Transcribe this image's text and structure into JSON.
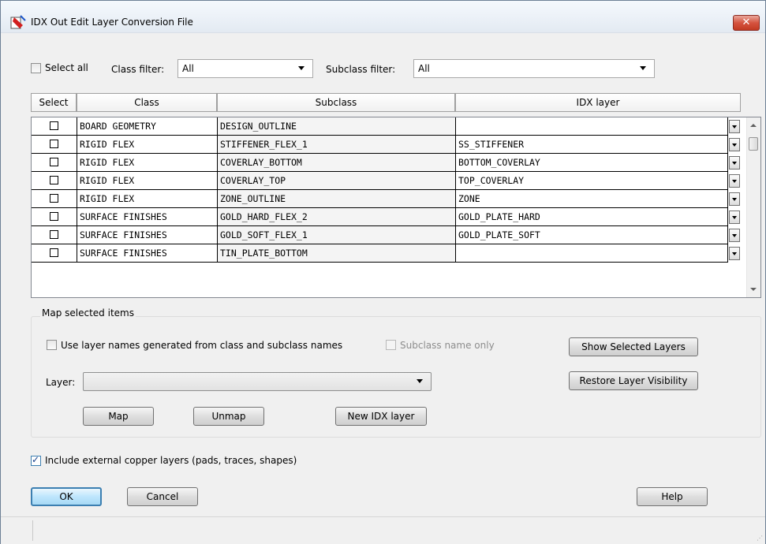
{
  "window": {
    "title": "IDX Out Edit Layer Conversion File",
    "close_label": "✕"
  },
  "filters": {
    "select_all_label": "Select all",
    "select_all_checked": false,
    "class_filter_label": "Class filter:",
    "class_filter_value": "All",
    "subclass_filter_label": "Subclass filter:",
    "subclass_filter_value": "All"
  },
  "table": {
    "headers": {
      "select": "Select",
      "class": "Class",
      "subclass": "Subclass",
      "idx_layer": "IDX layer"
    },
    "rows": [
      {
        "selected": false,
        "class": "BOARD GEOMETRY",
        "subclass": "DESIGN_OUTLINE",
        "idx_layer": ""
      },
      {
        "selected": false,
        "class": "RIGID FLEX",
        "subclass": "STIFFENER_FLEX_1",
        "idx_layer": "SS_STIFFENER"
      },
      {
        "selected": false,
        "class": "RIGID FLEX",
        "subclass": "COVERLAY_BOTTOM",
        "idx_layer": "BOTTOM_COVERLAY"
      },
      {
        "selected": false,
        "class": "RIGID FLEX",
        "subclass": "COVERLAY_TOP",
        "idx_layer": "TOP_COVERLAY"
      },
      {
        "selected": false,
        "class": "RIGID FLEX",
        "subclass": "ZONE_OUTLINE",
        "idx_layer": "ZONE"
      },
      {
        "selected": false,
        "class": "SURFACE FINISHES",
        "subclass": "GOLD_HARD_FLEX_2",
        "idx_layer": "GOLD_PLATE_HARD"
      },
      {
        "selected": false,
        "class": "SURFACE FINISHES",
        "subclass": "GOLD_SOFT_FLEX_1",
        "idx_layer": "GOLD_PLATE_SOFT"
      },
      {
        "selected": false,
        "class": "SURFACE FINISHES",
        "subclass": "TIN_PLATE_BOTTOM",
        "idx_layer": ""
      }
    ]
  },
  "map_group": {
    "title": "Map selected items",
    "use_layer_names_label": "Use layer names generated from class and subclass names",
    "use_layer_names_checked": false,
    "subclass_only_label": "Subclass name only",
    "subclass_only_checked": false,
    "layer_label": "Layer:",
    "layer_value": "",
    "map_button": "Map",
    "unmap_button": "Unmap",
    "new_idx_button": "New IDX layer",
    "show_selected_button": "Show Selected Layers",
    "restore_visibility_button": "Restore Layer Visibility"
  },
  "include_copper": {
    "label": "Include external copper layers (pads, traces, shapes)",
    "checked": true
  },
  "buttons": {
    "ok": "OK",
    "cancel": "Cancel",
    "help": "Help"
  }
}
